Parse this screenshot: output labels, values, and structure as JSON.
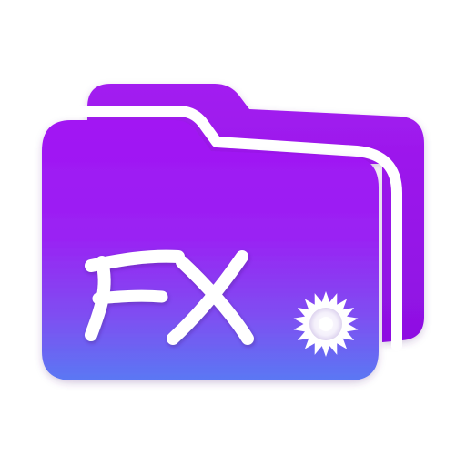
{
  "icon": {
    "logo_text": "FX",
    "glyph": "sun-badge-icon",
    "colors": {
      "back_folder": "#9b18ea",
      "front_top": "#a214f3",
      "front_mid": "#8a3cf2",
      "front_bottom": "#5a78f3",
      "outline": "#ffffff",
      "badge": "#ffffff"
    }
  }
}
